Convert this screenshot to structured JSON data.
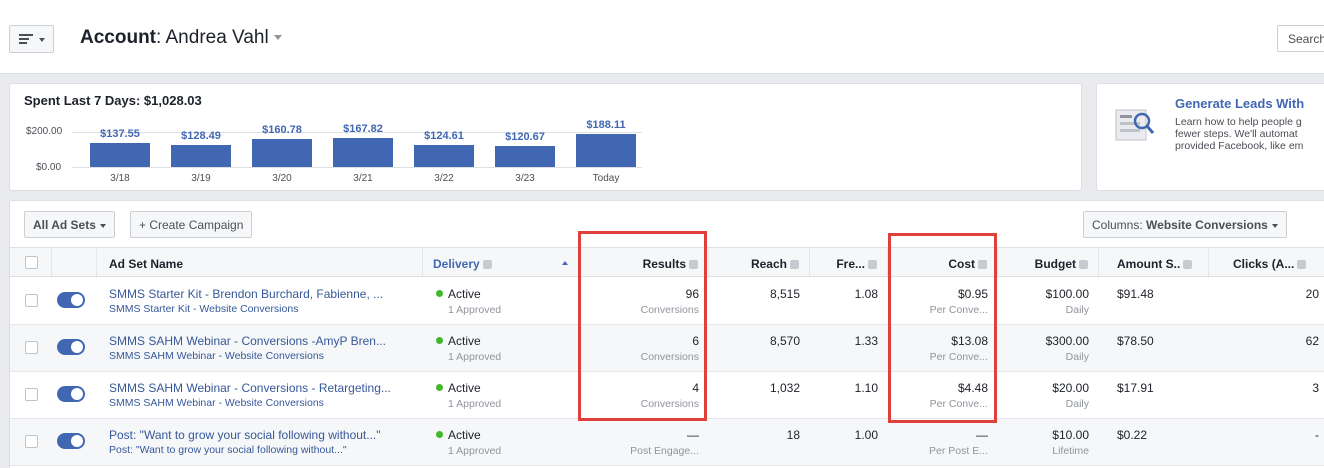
{
  "header": {
    "account_label": "Account",
    "account_name": ": Andrea Vahl",
    "search_label": "Search"
  },
  "spend": {
    "title": "Spent Last 7 Days: $1,028.03",
    "y_top_label": "$200.00",
    "y_bottom_label": "$0.00"
  },
  "chart_data": {
    "type": "bar",
    "title": "Spent Last 7 Days: $1,028.03",
    "categories": [
      "3/18",
      "3/19",
      "3/20",
      "3/21",
      "3/22",
      "3/23",
      "Today"
    ],
    "values": [
      137.55,
      128.49,
      160.78,
      167.82,
      124.61,
      120.67,
      188.11
    ],
    "value_labels": [
      "$137.55",
      "$128.49",
      "$160.78",
      "$167.82",
      "$124.61",
      "$120.67",
      "$188.11"
    ],
    "y_tick_labels": [
      "$200.00",
      "$0.00"
    ],
    "ylim": [
      0,
      200
    ],
    "color": "#4267b2"
  },
  "promo": {
    "title": "Generate Leads With",
    "lines": [
      "Learn how to help people g",
      "fewer steps. We'll automat",
      "provided Facebook, like em"
    ]
  },
  "toolbar": {
    "ad_sets_label": "All Ad Sets",
    "create_label": "+ Create Campaign",
    "columns_prefix": "Columns: ",
    "columns_value": "Website Conversions"
  },
  "table": {
    "headers": {
      "name": "Ad Set Name",
      "delivery": "Delivery",
      "results": "Results",
      "reach": "Reach",
      "frequency": "Fre...",
      "cost": "Cost",
      "budget": "Budget",
      "amount": "Amount S..",
      "clicks": "Clicks (A..."
    },
    "rows": [
      {
        "name": "SMMS Starter Kit - Brendon Burchard, Fabienne, ...",
        "campaign": "SMMS Starter Kit - Website Conversions",
        "delivery": "Active",
        "delivery_sub": "1 Approved",
        "results": "96",
        "results_sub": "Conversions",
        "reach": "8,515",
        "frequency": "1.08",
        "cost": "$0.95",
        "cost_sub": "Per Conve...",
        "budget": "$100.00",
        "budget_sub": "Daily",
        "amount": "$91.48",
        "clicks": "20"
      },
      {
        "name": "SMMS SAHM Webinar - Conversions -AmyP Bren...",
        "campaign": "SMMS SAHM Webinar - Website Conversions",
        "delivery": "Active",
        "delivery_sub": "1 Approved",
        "results": "6",
        "results_sub": "Conversions",
        "reach": "8,570",
        "frequency": "1.33",
        "cost": "$13.08",
        "cost_sub": "Per Conve...",
        "budget": "$300.00",
        "budget_sub": "Daily",
        "amount": "$78.50",
        "clicks": "62"
      },
      {
        "name": "SMMS SAHM Webinar - Conversions - Retargeting...",
        "campaign": "SMMS SAHM Webinar - Website Conversions",
        "delivery": "Active",
        "delivery_sub": "1 Approved",
        "results": "4",
        "results_sub": "Conversions",
        "reach": "1,032",
        "frequency": "1.10",
        "cost": "$4.48",
        "cost_sub": "Per Conve...",
        "budget": "$20.00",
        "budget_sub": "Daily",
        "amount": "$17.91",
        "clicks": "3"
      },
      {
        "name": "Post: \"Want to grow your social following without...\"",
        "campaign": "Post: \"Want to grow your social following without...\"",
        "delivery": "Active",
        "delivery_sub": "1 Approved",
        "results": "—",
        "results_sub": "Post Engage...",
        "reach": "18",
        "frequency": "1.00",
        "cost": "—",
        "cost_sub": "Per Post E...",
        "budget": "$10.00",
        "budget_sub": "Lifetime",
        "amount": "$0.22",
        "clicks": "-"
      }
    ]
  },
  "colors": {
    "accent": "#4267b2",
    "active_dot": "#42b72a",
    "highlight": "#e0403a"
  }
}
